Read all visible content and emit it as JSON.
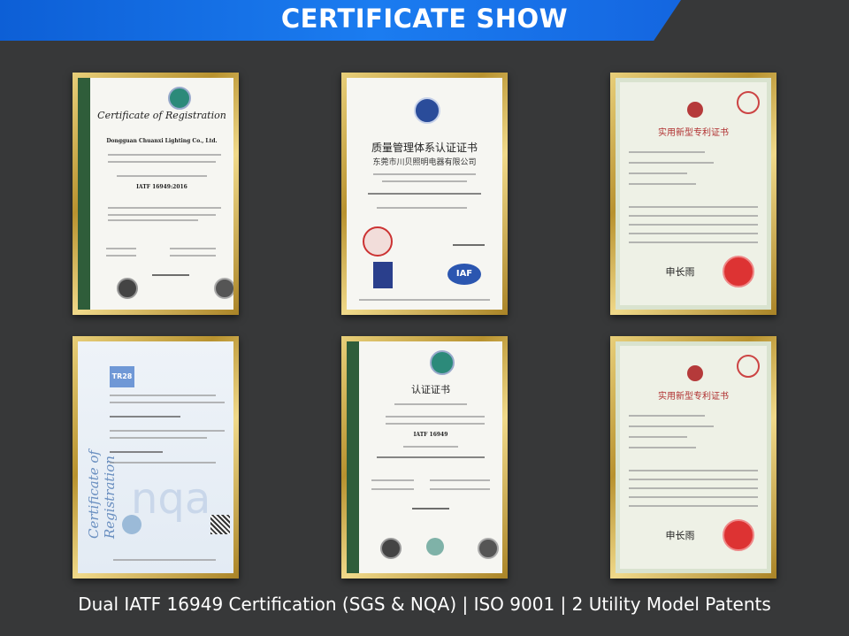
{
  "header": {
    "title": "CERTIFICATE SHOW"
  },
  "caption": "Dual IATF 16949 Certification (SGS & NQA) | ISO 9001 | 2 Utility Model Patents",
  "certificates": [
    {
      "title": "Certificate of Registration",
      "company": "Dongguan Chuanxi Lighting Co., Ltd.",
      "standard": "IATF 16949:2016"
    },
    {
      "title": "质量管理体系认证证书",
      "company": "东莞市川贝照明电器有限公司",
      "badge": "IAF"
    },
    {
      "title": "实用新型专利证书",
      "signature": "申长雨"
    },
    {
      "title": "Certificate of Registration",
      "badge": "TR28"
    },
    {
      "title": "认证证书",
      "standard": "IATF 16949"
    },
    {
      "title": "实用新型专利证书",
      "signature": "申长雨"
    }
  ],
  "colors": {
    "accent": "#1b7cf0",
    "background": "#373839",
    "frame": "#c9a43f"
  }
}
